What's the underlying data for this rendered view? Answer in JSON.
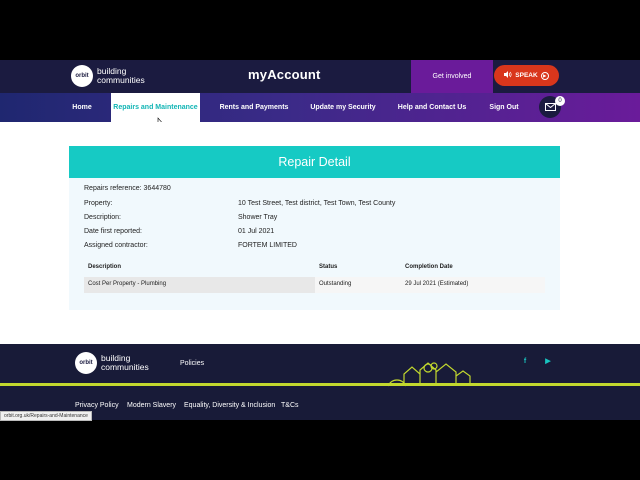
{
  "header": {
    "logo_mark": "orbit",
    "logo_line1": "building",
    "logo_line2": "communities",
    "title": "myAccount",
    "get_involved": "Get involved",
    "speak": "SPEAK"
  },
  "nav": {
    "items": [
      {
        "label": "Home"
      },
      {
        "label": "Repairs and Maintenance"
      },
      {
        "label": "Rents and Payments"
      },
      {
        "label": "Update my Security"
      },
      {
        "label": "Help and Contact Us"
      },
      {
        "label": "Sign Out"
      }
    ],
    "active_index": 1,
    "mail_badge": "0"
  },
  "repair": {
    "heading": "Repair Detail",
    "reference_label": "Repairs reference: 3644780",
    "fields": [
      {
        "label": "Property:",
        "value": "10 Test Street, Test district, Test Town, Test County"
      },
      {
        "label": "Description:",
        "value": "Shower Tray"
      },
      {
        "label": "Date first reported:",
        "value": "01 Jul 2021"
      },
      {
        "label": "Assigned contractor:",
        "value": "FORTEM LIMITED"
      }
    ],
    "table": {
      "headers": [
        "Description",
        "Status",
        "Completion Date"
      ],
      "rows": [
        [
          "Cost Per Property - Plumbing",
          "Outstanding",
          "29 Jul 2021 (Estimated)"
        ]
      ]
    }
  },
  "footer": {
    "logo_mark": "orbit",
    "logo_line1": "building",
    "logo_line2": "communities",
    "policies": "Policies",
    "links": [
      "Privacy Policy",
      "Modern Slavery",
      "Equality, Diversity & Inclusion",
      "T&Cs"
    ],
    "social": [
      {
        "icon": "facebook-icon",
        "glyph": "f"
      },
      {
        "icon": "youtube-icon",
        "glyph": "▶"
      }
    ],
    "status_url": "orbit.org.uk/Repairs-and-Maintenance"
  },
  "colors": {
    "header_bg": "#1b1b40",
    "accent_teal": "#16cac4",
    "accent_purple": "#6a1b9a",
    "speak_red": "#d9361c",
    "footer_line": "#c2d82e"
  }
}
